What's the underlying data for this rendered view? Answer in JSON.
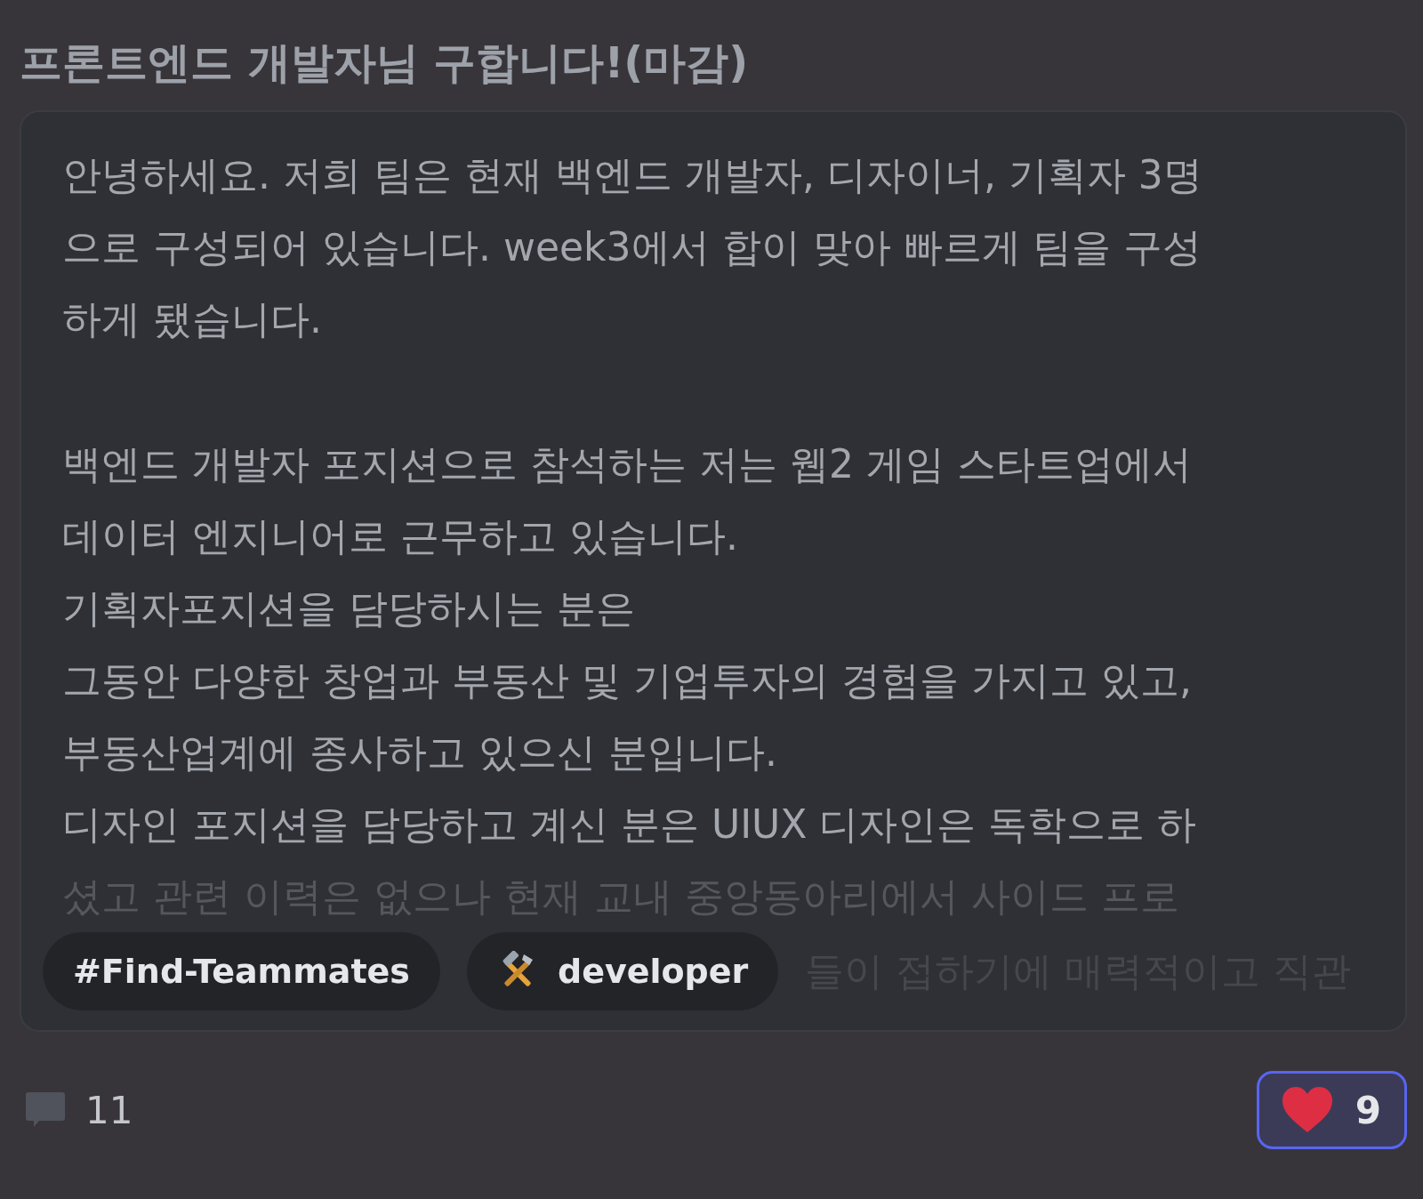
{
  "post": {
    "title": "프론트엔드 개발자님 구합니다!(마감)",
    "paragraphs": [
      {
        "lines": [
          "안녕하세요. 저희 팀은 현재 백엔드 개발자, 디자이너, 기획자 3명",
          "으로 구성되어 있습니다. week3에서 합이 맞아 빠르게 팀을 구성",
          "하게 됐습니다."
        ]
      },
      {
        "lines": [
          "백엔드 개발자 포지션으로 참석하는 저는 웹2 게임 스타트업에서",
          "데이터 엔지니어로 근무하고 있습니다.",
          "기획자포지션을 담당하시는 분은",
          "그동안 다양한 창업과 부동산 및 기업투자의 경험을 가지고 있고,",
          "부동산업계에 종사하고 있으신 분입니다.",
          "디자인 포지션을 담당하고 계신 분은 UIUX 디자인은 독학으로 하"
        ]
      }
    ],
    "faded_line": "셨고 관련 이력은 없으나 현재 교내 중앙동아리에서 사이드 프로",
    "tags": [
      {
        "kind": "channel",
        "label": "#Find-Teammates"
      },
      {
        "kind": "role",
        "label": "developer"
      }
    ],
    "hidden_tail": "들이 접하기에 매력적이고 직관",
    "comments": "11",
    "reaction": {
      "count": "9",
      "selected": true
    }
  }
}
